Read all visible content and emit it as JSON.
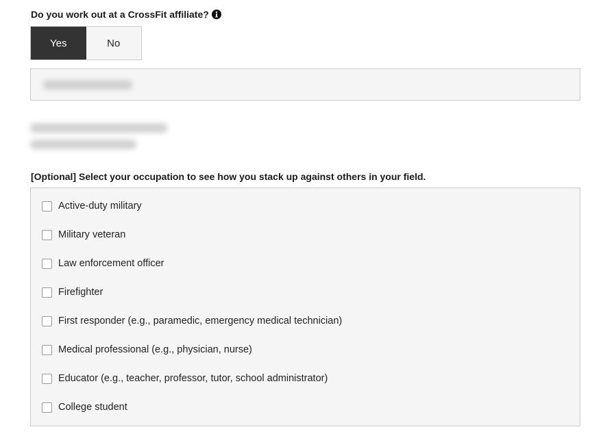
{
  "affiliate_question": {
    "label": "Do you work out at a CrossFit affiliate?",
    "info_icon": "info-circle-icon",
    "options": [
      {
        "label": "Yes",
        "selected": true
      },
      {
        "label": "No",
        "selected": false
      }
    ]
  },
  "affiliate_field": {
    "value_redacted": true
  },
  "optional_label": "[Optional] Select your occupation to see how you stack up against others in your field.",
  "occupations": [
    {
      "label": "Active-duty military",
      "checked": false
    },
    {
      "label": "Military veteran",
      "checked": false
    },
    {
      "label": "Law enforcement officer",
      "checked": false
    },
    {
      "label": "Firefighter",
      "checked": false
    },
    {
      "label": "First responder (e.g., paramedic, emergency medical technician)",
      "checked": false
    },
    {
      "label": "Medical professional (e.g., physician, nurse)",
      "checked": false
    },
    {
      "label": "Educator (e.g., teacher, professor, tutor, school administrator)",
      "checked": false
    },
    {
      "label": "College student",
      "checked": false
    }
  ],
  "colors": {
    "selected_bg": "#333333",
    "unselected_bg": "#f5f5f5",
    "border": "#cccccc"
  }
}
